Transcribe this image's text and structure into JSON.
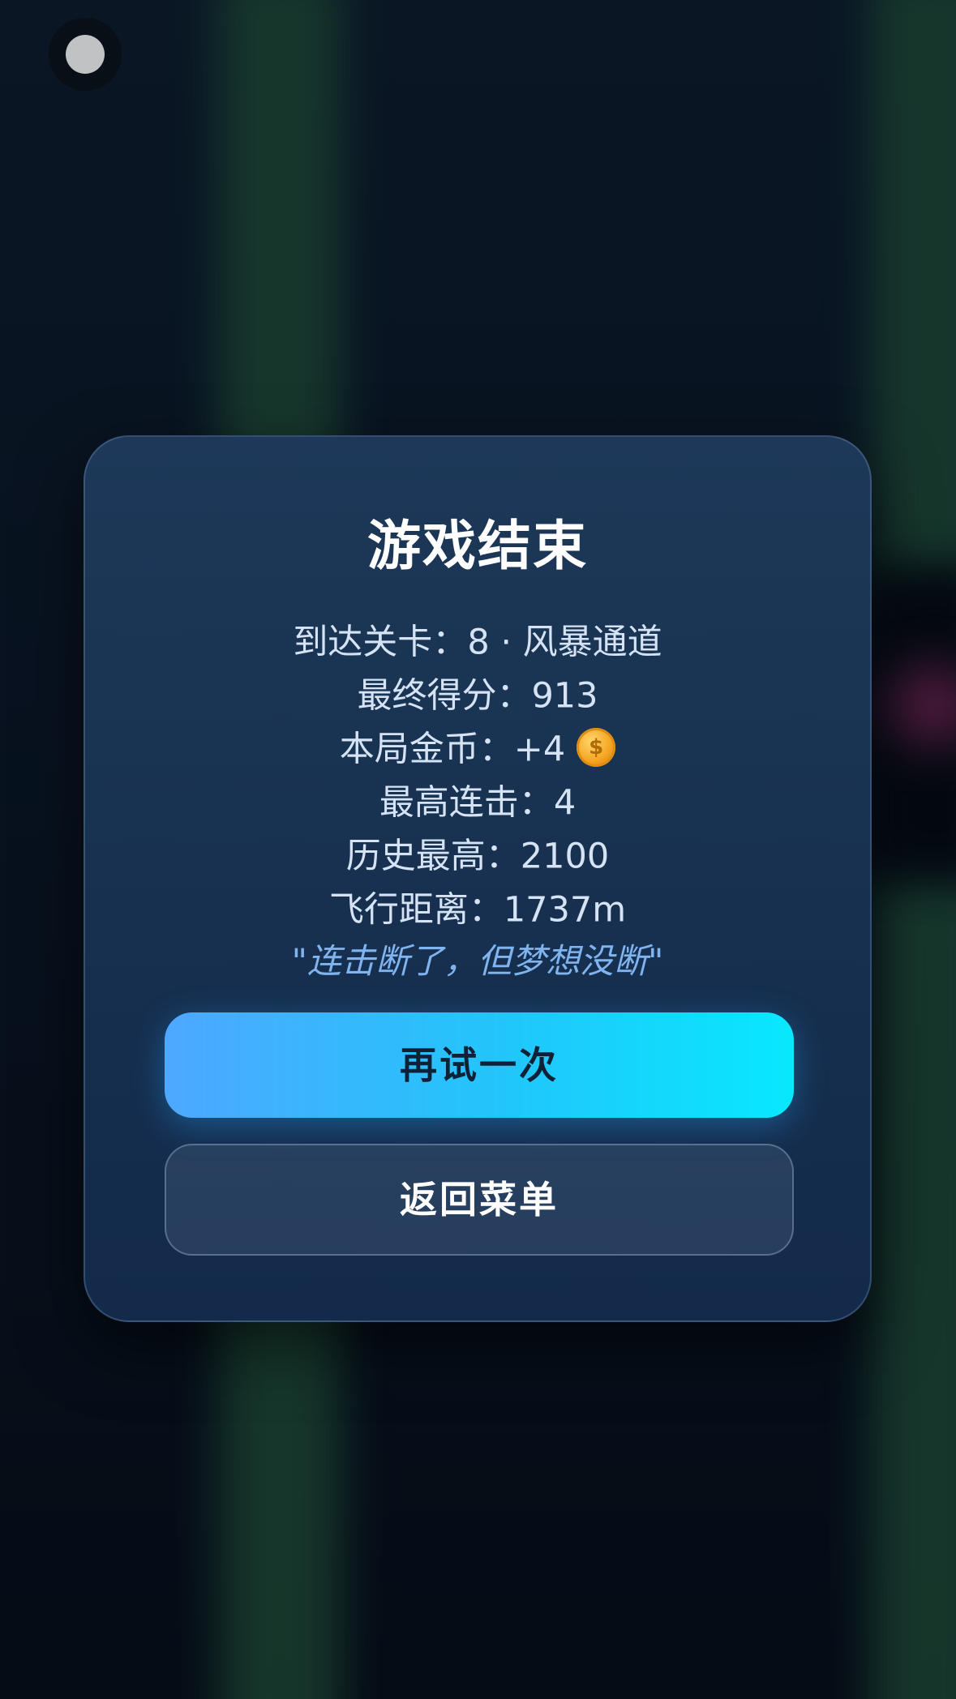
{
  "modal": {
    "title": "游戏结束",
    "stats": [
      {
        "label": "到达关卡：",
        "value": "8 · 风暴通道"
      },
      {
        "label": "最终得分：",
        "value": "913"
      },
      {
        "label": "本局金币：",
        "value": "+4",
        "icon": "coin-icon"
      },
      {
        "label": "最高连击：",
        "value": "4"
      },
      {
        "label": "历史最高：",
        "value": "2100"
      },
      {
        "label": "飞行距离：",
        "value": "1737m"
      }
    ],
    "quote": "\"连击断了，但梦想没断\"",
    "retry_label": "再试一次",
    "menu_label": "返回菜单"
  },
  "colors": {
    "retry_gradient_start": "#4ea8ff",
    "retry_gradient_end": "#08e8fd",
    "quote_color": "#7fb4ef",
    "modal_bg": "#1b3555"
  }
}
